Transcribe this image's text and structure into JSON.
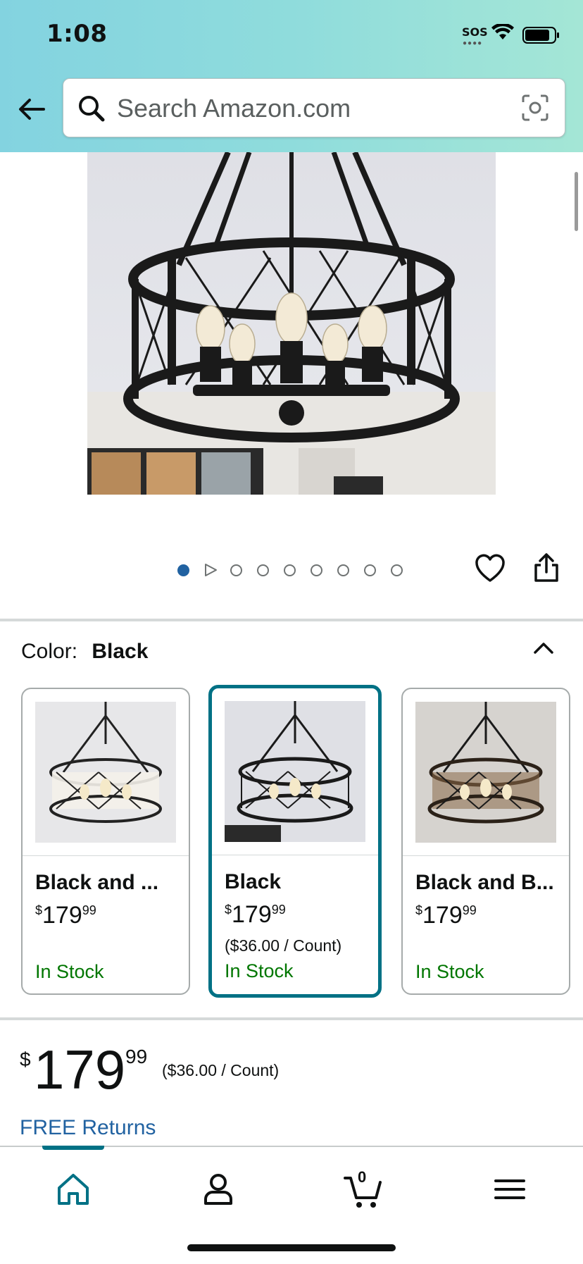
{
  "status_bar": {
    "time": "1:08",
    "sos": "SOS"
  },
  "search": {
    "placeholder": "Search Amazon.com"
  },
  "image_carousel": {
    "total_dots": 9,
    "active_index": 0
  },
  "color_selector": {
    "label": "Color:",
    "selected": "Black"
  },
  "swatches": [
    {
      "name": "Black and ...",
      "price_whole": "179",
      "price_fraction": "99",
      "unit_price": "",
      "stock": "In Stock"
    },
    {
      "name": "Black",
      "price_whole": "179",
      "price_fraction": "99",
      "unit_price": "($36.00 / Count)",
      "stock": "In Stock"
    },
    {
      "name": "Black and B...",
      "price_whole": "179",
      "price_fraction": "99",
      "unit_price": "",
      "stock": "In Stock"
    }
  ],
  "price": {
    "currency": "$",
    "whole": "179",
    "fraction": "99",
    "unit_price": "($36.00 / Count)"
  },
  "returns": {
    "label": "FREE Returns"
  },
  "bottom_nav": {
    "cart_count": "0"
  },
  "colors": {
    "accent_teal": "#007185",
    "link_blue": "#2162a1",
    "stock_green": "#007600"
  },
  "icons": [
    "back-arrow-icon",
    "search-icon",
    "camera-icon",
    "play-icon",
    "heart-icon",
    "share-icon",
    "chevron-up-icon",
    "home-icon",
    "account-icon",
    "cart-icon",
    "menu-icon"
  ]
}
